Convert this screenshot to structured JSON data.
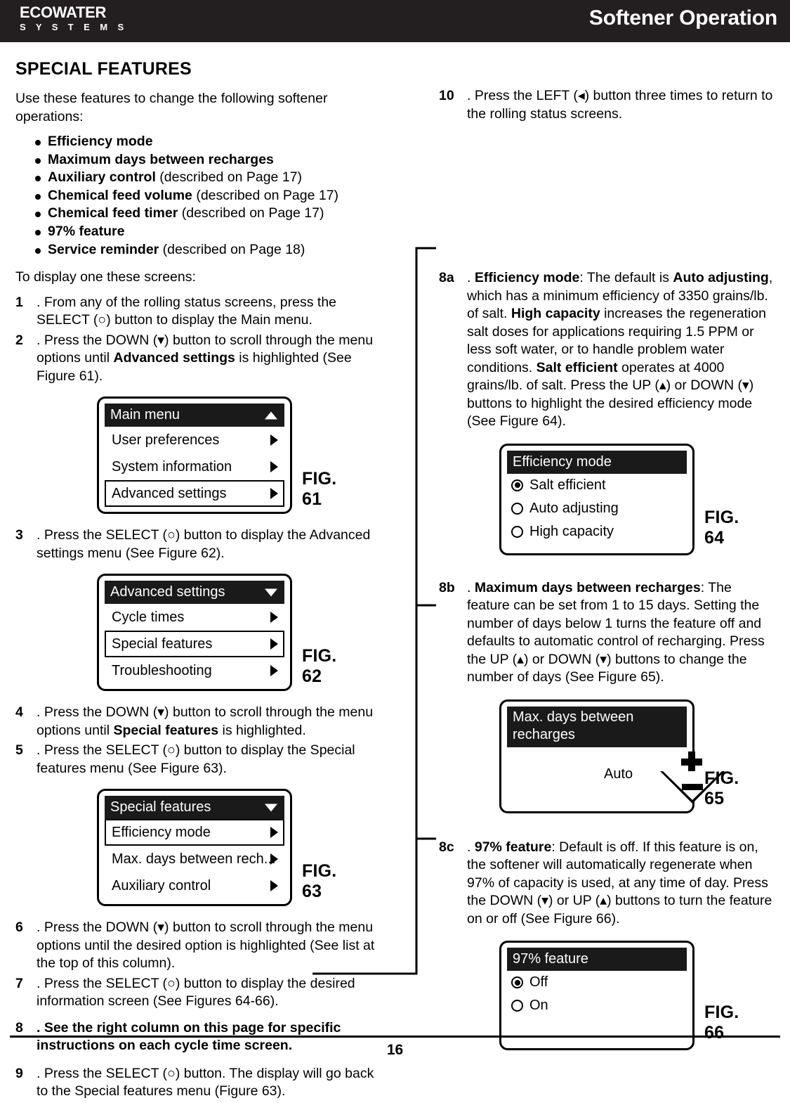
{
  "header": {
    "brand_main": "ECOWATER",
    "brand_sub": "S Y S T E M S",
    "title": "Softener Operation"
  },
  "section_title": "SPECIAL FEATURES",
  "left_column": {
    "intro": "Use these features to change the following softener operations:",
    "features": [
      {
        "bold": "Efficiency mode",
        "rest": ""
      },
      {
        "bold": "Maximum days between recharges",
        "rest": ""
      },
      {
        "bold": "Auxiliary control",
        "rest": " (described on Page 17)"
      },
      {
        "bold": "Chemical feed volume",
        "rest": " (described on Page 17)"
      },
      {
        "bold": "Chemical feed timer",
        "rest": " (described on Page 17)"
      },
      {
        "bold": "97% feature",
        "rest": ""
      },
      {
        "bold": "Service reminder",
        "rest": " (described on Page 18)"
      }
    ],
    "to_display": "To display one these screens:",
    "steps": {
      "s1_num": "1",
      "s1_text": ". From any of the rolling status screens, press the SELECT (○) button to display the Main menu.",
      "s2_num": "2",
      "s2_a": ". Press the DOWN (▾) button to scroll through the menu options until ",
      "s2_b": "Advanced settings",
      "s2_c": " is highlighted (See Figure 61).",
      "s3_num": "3",
      "s3_text": ". Press the SELECT (○) button to display the Advanced settings menu (See Figure 62).",
      "s4_num": "4",
      "s4_a": ". Press the DOWN (▾) button to scroll through the menu options until ",
      "s4_b": "Special features",
      "s4_c": " is highlighted.",
      "s5_num": "5",
      "s5_text": ". Press the SELECT (○) button to display the Special features menu (See Figure 63).",
      "s6_num": "6",
      "s6_text": ". Press the DOWN (▾) button to scroll through the menu options until the desired option is highlighted (See list at the top of this column).",
      "s7_num": "7",
      "s7_text": ". Press the SELECT (○) button to display the desired information screen (See Figures 64-66).",
      "s8_num": "8",
      "s8_text": ". See the right column on this page for specific instructions on each cycle time screen.",
      "s9_num": "9",
      "s9_text": ". Press the SELECT (○) button.  The display will go back to the Special features menu (Figure 63)."
    }
  },
  "right_column": {
    "s10_num": "10",
    "s10_text": ". Press the LEFT (◂) button three times to return to the rolling status screens.",
    "s8a_num": "8a",
    "s8a_p1": ". ",
    "s8a_b1": "Efficiency mode",
    "s8a_t1": ": The default is ",
    "s8a_b2": "Auto adjusting",
    "s8a_t2": ", which has a minimum efficiency of 3350 grains/lb. of salt.  ",
    "s8a_b3": "High capacity",
    "s8a_t3": " increases the regeneration salt doses for applications requiring 1.5 PPM or less soft water, or to handle problem water conditions.  ",
    "s8a_b4": "Salt efficient",
    "s8a_t4": " operates at 4000 grains/lb. of salt.  Press the UP (▴) or DOWN (▾) buttons to highlight the desired efficiency mode (See Figure 64).",
    "s8b_num": "8b",
    "s8b_p1": ". ",
    "s8b_b1": "Maximum days between recharges",
    "s8b_t1": ": The feature can be set from 1 to 15 days.  Setting the number of days below 1 turns the feature off and defaults to automatic control of recharging.  Press the UP (▴) or DOWN (▾) buttons to change the number of days (See Figure 65).",
    "s8c_num": "8c",
    "s8c_p1": ". ",
    "s8c_b1": "97% feature",
    "s8c_t1": ": Default is off.  If this feature is on, the softener will automatically regenerate when 97% of capacity is used, at any time of day.  Press the DOWN (▾) or UP (▴) buttons to turn the feature on or off (See Figure 66)."
  },
  "figures": {
    "fig61": {
      "label": "FIG. 61",
      "header": "Main menu",
      "header_arrow": "arrow-up-icon",
      "rows": [
        {
          "label": "User preferences",
          "selected": false
        },
        {
          "label": "System information",
          "selected": false
        },
        {
          "label": "Advanced settings",
          "selected": true
        }
      ]
    },
    "fig62": {
      "label": "FIG. 62",
      "header": "Advanced settings",
      "header_arrow": "arrow-down-icon",
      "rows": [
        {
          "label": "Cycle times",
          "selected": false
        },
        {
          "label": "Special features",
          "selected": true
        },
        {
          "label": "Troubleshooting",
          "selected": false
        }
      ]
    },
    "fig63": {
      "label": "FIG. 63",
      "header": "Special features",
      "header_arrow": "arrow-down-icon",
      "rows": [
        {
          "label": "Efficiency mode",
          "selected": true
        },
        {
          "label": "Max. days between rech...",
          "selected": false
        },
        {
          "label": "Auxiliary control",
          "selected": false
        }
      ]
    },
    "fig64": {
      "label": "FIG. 64",
      "header": "Efficiency mode",
      "options": [
        {
          "label": "Salt efficient",
          "selected": true
        },
        {
          "label": "Auto adjusting",
          "selected": false
        },
        {
          "label": "High capacity",
          "selected": false
        }
      ]
    },
    "fig65": {
      "label": "FIG. 65",
      "header_line1": "Max. days between",
      "header_line2": "recharges",
      "value": "Auto",
      "plus_icon": "plus-icon",
      "minus_icon": "minus-icon"
    },
    "fig66": {
      "label": "FIG. 66",
      "header": "97% feature",
      "options": [
        {
          "label": "Off",
          "selected": true
        },
        {
          "label": "On",
          "selected": false
        }
      ]
    }
  },
  "footer": {
    "page_number": "16"
  },
  "colors": {
    "header_bg": "#231f20",
    "lcd_header_bg": "#1a1a1a",
    "text": "#000000",
    "page_bg": "#ffffff"
  }
}
